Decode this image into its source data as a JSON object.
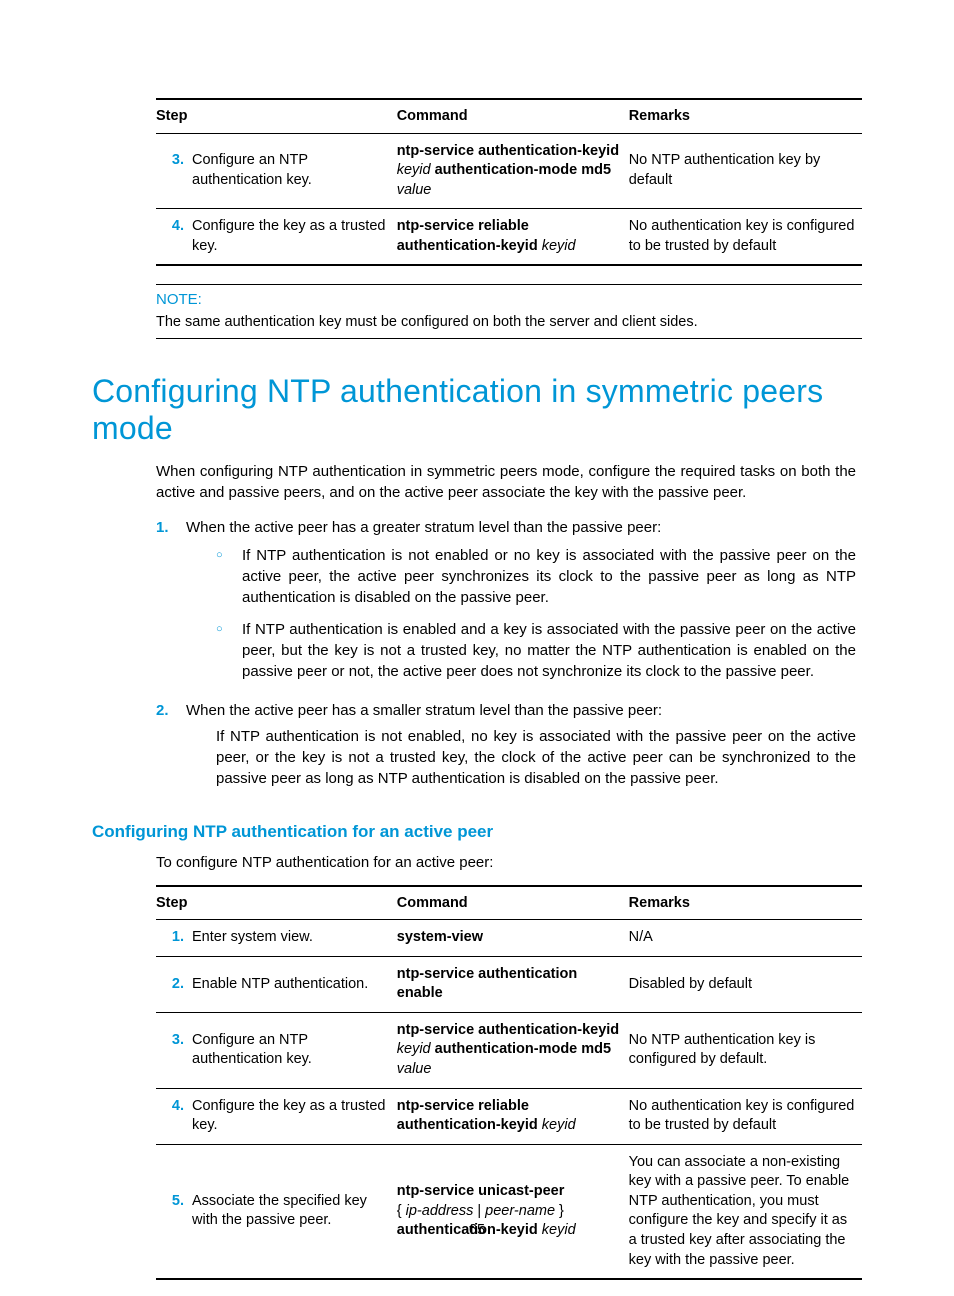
{
  "table1": {
    "headers": {
      "step": "Step",
      "command": "Command",
      "remarks": "Remarks"
    },
    "rows": [
      {
        "num": "3.",
        "step": "Configure an NTP authentication key.",
        "cmd_b1": "ntp-service authentication-keyid",
        "cmd_i1": "keyid",
        "cmd_b2": "authentication-mode md5",
        "cmd_i2": "value",
        "remarks": "No NTP authentication key by default"
      },
      {
        "num": "4.",
        "step": "Configure the key as a trusted key.",
        "cmd_b1": "ntp-service reliable authentication-keyid",
        "cmd_i1": "keyid",
        "remarks": "No authentication key is configured to be trusted by default"
      }
    ]
  },
  "note": {
    "label": "NOTE:",
    "body": "The same authentication key must be configured on both the server and client sides."
  },
  "h1": "Configuring NTP authentication in symmetric peers mode",
  "intro": "When configuring NTP authentication in symmetric peers mode, configure the required tasks on both the active and passive peers, and on the active peer associate the key with the passive peer.",
  "list": {
    "item1": {
      "num": "1.",
      "text": "When the active peer has a greater stratum level than the passive peer:",
      "sub1": "If NTP authentication is not enabled or no key is associated with the passive peer on the active peer, the active peer synchronizes its clock to the passive peer as long as NTP authentication is disabled on the passive peer.",
      "sub2": "If NTP authentication is enabled and a key is associated with the passive peer on the active peer, but the key is not a trusted key, no matter the NTP authentication is enabled on the passive peer or not, the active peer does not synchronize its clock to the passive peer."
    },
    "item2": {
      "num": "2.",
      "text": "When the active peer has a smaller stratum level than the passive peer:",
      "follow": "If NTP authentication is not enabled, no key is associated with the passive peer on the active peer, or the key is not a trusted key, the clock of the active peer can be synchronized to the passive peer as long as NTP authentication is disabled on the passive peer."
    }
  },
  "h2": "Configuring NTP authentication for an active peer",
  "lead2": "To configure NTP authentication for an active peer:",
  "table2": {
    "headers": {
      "step": "Step",
      "command": "Command",
      "remarks": "Remarks"
    },
    "rows": [
      {
        "num": "1.",
        "step": "Enter system view.",
        "cmd_b1": "system-view",
        "remarks": "N/A"
      },
      {
        "num": "2.",
        "step": "Enable NTP authentication.",
        "cmd_b1": "ntp-service authentication enable",
        "remarks": "Disabled by default"
      },
      {
        "num": "3.",
        "step": "Configure an NTP authentication key.",
        "cmd_b1": "ntp-service authentication-keyid",
        "cmd_i1": "keyid",
        "cmd_b2": "authentication-mode md5",
        "cmd_i2": "value",
        "remarks": "No NTP authentication key is configured by default."
      },
      {
        "num": "4.",
        "step": "Configure the key as a trusted key.",
        "cmd_b1": "ntp-service reliable authentication-keyid",
        "cmd_i1": "keyid",
        "remarks": "No authentication key is configured to be trusted by default"
      },
      {
        "num": "5.",
        "step": "Associate the specified key with the passive peer.",
        "cmd_b1": "ntp-service unicast-peer",
        "cmd_plain": "{ ",
        "cmd_i1": "ip-address",
        "cmd_mid": " | ",
        "cmd_i2": "peer-name",
        "cmd_plain2": " }",
        "cmd_b2": "authentication-keyid",
        "cmd_i3": "keyid",
        "remarks": "You can associate a non-existing key with a passive peer. To enable NTP authentication, you must configure the key and specify it as a trusted key after associating the key with the passive peer."
      }
    ]
  },
  "pagenum": "65"
}
